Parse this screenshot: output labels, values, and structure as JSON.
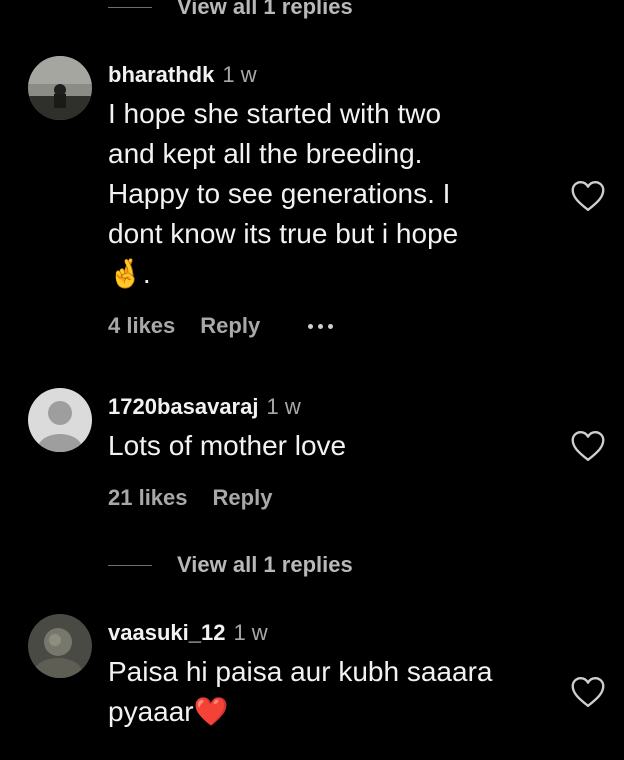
{
  "top_replies": {
    "label": "View all 1 replies"
  },
  "comments": [
    {
      "username": "bharathdk",
      "time": "1 w",
      "text_lines": [
        "I hope she started with two",
        "and kept all the breeding.",
        "Happy to see generations. I",
        "dont know its true but i hope",
        "🤞."
      ],
      "likes": "4 likes",
      "reply": "Reply"
    },
    {
      "username": "1720basavaraj",
      "time": "1 w",
      "text_lines": [
        "Lots of mother love"
      ],
      "likes": "21 likes",
      "reply": "Reply"
    },
    {
      "username": "vaasuki_12",
      "time": "1 w",
      "text_lines": [
        "Paisa hi paisa aur kubh saaara",
        "pyaaar❤️"
      ]
    }
  ],
  "mid_replies": {
    "label": "View all 1 replies"
  },
  "icons": {
    "like": "heart-outline-icon",
    "more": "more-dots-icon",
    "default_avatar": "person-icon"
  },
  "colors": {
    "background": "#000000",
    "secondary_text": "#a8a8a8"
  }
}
